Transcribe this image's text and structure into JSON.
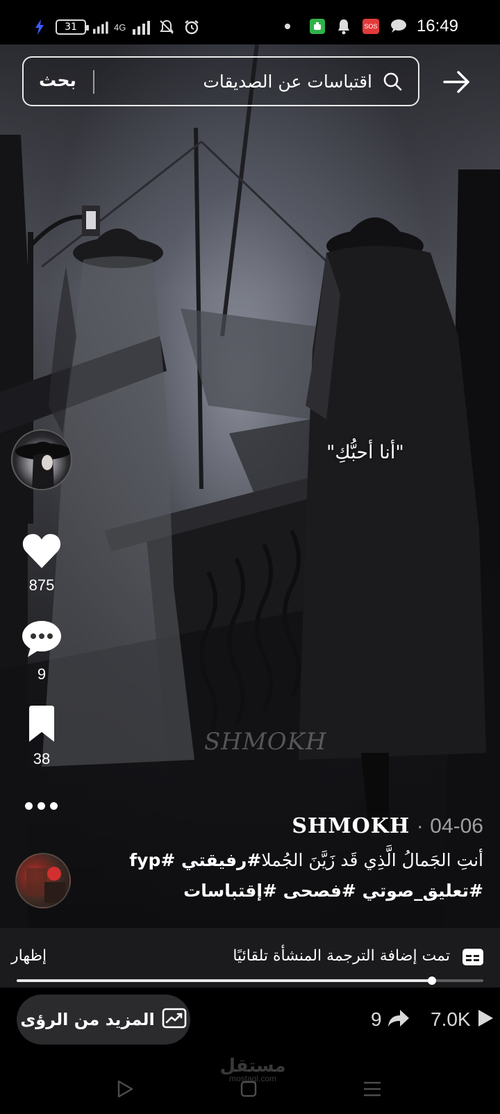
{
  "status_bar": {
    "battery": "31",
    "network": "4G",
    "time": "16:49",
    "sos_label": "SOS"
  },
  "search": {
    "query": "اقتباسات عن الصديقات",
    "button_label": "بحث"
  },
  "video": {
    "overlay_text": "\"أنا أحبُّكِ\"",
    "watermark": "SHMOKH"
  },
  "actions": {
    "likes": "875",
    "comments": "9",
    "saves": "38"
  },
  "caption": {
    "author": "SHMOKH",
    "separator": "·",
    "date": "04-06",
    "line1_plain": "أنتِ الجَمالُ الَّذِي قَد زَيَّنَ الجُملا",
    "line1_tags": "#رفيقتي #fyp",
    "line2_tags": "#تعليق_صوتي #فصحى #إقتباسات"
  },
  "translate_banner": {
    "text": "تمت إضافة الترجمة المنشأة تلقائيًا",
    "show_label": "إظهار"
  },
  "playback": {
    "progress": 0.89
  },
  "bottom": {
    "insights_label": "المزيد من الرؤى",
    "shares": "9",
    "views": "7.0K"
  },
  "nav_brand": {
    "arabic": "مستقل",
    "latin": "mostaql.com"
  },
  "colors": {
    "sos_red": "#e23a3a",
    "battery_saver_green": "#2fb24a",
    "banner_bg": "#1b1b1d",
    "pill_bg": "#2b2b2e"
  }
}
